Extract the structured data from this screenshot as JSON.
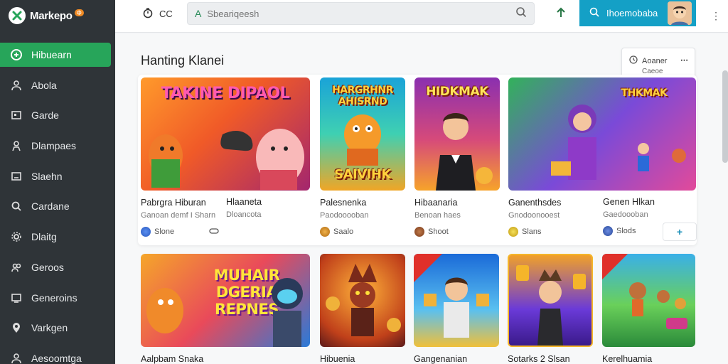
{
  "brand": {
    "name": "Markepo",
    "badge": "Φ"
  },
  "nav": [
    {
      "label": "Hibuearn",
      "icon": "gamepad-icon",
      "active": true
    },
    {
      "label": "Abola",
      "icon": "user-icon"
    },
    {
      "label": "Garde",
      "icon": "image-icon"
    },
    {
      "label": "Dlampaes",
      "icon": "person-icon"
    },
    {
      "label": "Slaehn",
      "icon": "bar-chart-icon"
    },
    {
      "label": "Cardane",
      "icon": "search-icon"
    },
    {
      "label": "Dlaitg",
      "icon": "gear-icon"
    },
    {
      "label": "Geroos",
      "icon": "user-group-icon"
    },
    {
      "label": "Generoins",
      "icon": "monitor-icon"
    },
    {
      "label": "Varkgen",
      "icon": "pin-icon"
    },
    {
      "label": "Aesoomtga",
      "icon": "user-icon"
    }
  ],
  "topbar": {
    "left_label": "CC",
    "search_placeholder": "Sbeariqeesh",
    "cta_label": "Ihoemobaba"
  },
  "section": {
    "title": "Hanting Klanei"
  },
  "filter": {
    "label": "Aoaner",
    "sub": "Caeoe"
  },
  "row1": [
    {
      "title": "Pabrgra Hiburan",
      "sub": "Ganoan demf I Sharn",
      "meta": "Slone",
      "thumb_text": "TAKINE DIPAOL"
    },
    {
      "title": "Hlaaneta",
      "sub": "Dloancota",
      "meta": "",
      "thumb_text": ""
    },
    {
      "title": "Palesnenka",
      "sub": "Paodooooban",
      "meta": "Saalo",
      "thumb_text": "HARGRHNR AHISRND"
    },
    {
      "title": "Hibaanaria",
      "sub": "Benoan haes",
      "meta": "Shoot",
      "thumb_text": "HIDKMAK"
    },
    {
      "title": "Ganenthsdes",
      "sub": "Gnodoonooest",
      "meta": "Slans",
      "thumb_text": ""
    },
    {
      "title": "Genen Hlkan",
      "sub": "Gaedoooban",
      "meta": "Slods",
      "thumb_text": "THKMAK"
    }
  ],
  "row1_extra": {
    "thumb_bottom_text": "SAIVIHK",
    "meta_extra": "⋯"
  },
  "row2": [
    {
      "title": "Aalpbam Snaka",
      "thumb_text": "MUHAIR DGERIA REPNES"
    },
    {
      "title": "Hibuenia",
      "thumb_text": ""
    },
    {
      "title": "Gangenanian",
      "thumb_text": ""
    },
    {
      "title": "Sotarks 2 Slsan",
      "thumb_text": ""
    },
    {
      "title": "Kerelhuamia",
      "thumb_text": ""
    }
  ],
  "colors": {
    "sidebar": "#2f3438",
    "active": "#27a55a",
    "cta": "#14a0c6"
  }
}
